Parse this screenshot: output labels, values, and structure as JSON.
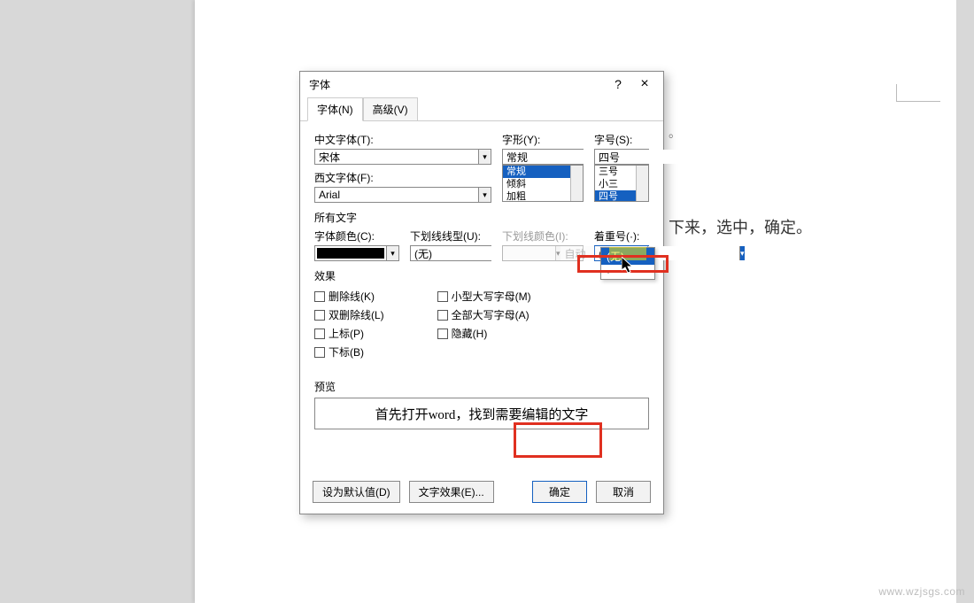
{
  "document": {
    "visible_text": "下来，选中，确定。",
    "corner_marker": "。"
  },
  "watermark": "www.wzjsgs.com",
  "dialog": {
    "title": "字体",
    "help": "?",
    "close": "×",
    "tabs": {
      "font": "字体(N)",
      "advanced": "高级(V)"
    },
    "labels": {
      "chinese_font": "中文字体(T):",
      "western_font": "西文字体(F):",
      "style": "字形(Y):",
      "size": "字号(S):",
      "all_text": "所有文字",
      "font_color": "字体颜色(C):",
      "underline_style": "下划线线型(U):",
      "underline_color": "下划线颜色(I):",
      "emphasis": "着重号(·):",
      "effects": "效果",
      "preview": "预览"
    },
    "values": {
      "chinese_font": "宋体",
      "western_font": "Arial",
      "style": "常规",
      "size": "四号",
      "underline_style": "(无)",
      "underline_color": "自动",
      "emphasis": "(无)"
    },
    "style_list": [
      "常规",
      "倾斜",
      "加粗"
    ],
    "size_list": [
      "三号",
      "小三",
      "四号"
    ],
    "emphasis_options": [
      "(无)",
      "·"
    ],
    "effects_checks": {
      "strikethrough": "删除线(K)",
      "double_strike": "双删除线(L)",
      "superscript": "上标(P)",
      "subscript": "下标(B)",
      "smallcaps": "小型大写字母(M)",
      "allcaps": "全部大写字母(A)",
      "hidden": "隐藏(H)"
    },
    "preview_text": "首先打开word，找到需要编辑的文字",
    "buttons": {
      "set_default": "设为默认值(D)",
      "text_effects": "文字效果(E)...",
      "ok": "确定",
      "cancel": "取消"
    }
  }
}
